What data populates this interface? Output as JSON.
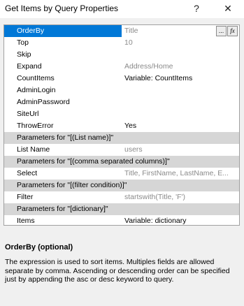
{
  "window": {
    "title": "Get Items by Query Properties",
    "help_label": "?",
    "close_label": "✕"
  },
  "grid": {
    "rows": [
      {
        "type": "prop",
        "name": "OrderBy",
        "value": "Title",
        "selected": true,
        "value_color": "gray"
      },
      {
        "type": "prop",
        "name": "Top",
        "value": "10",
        "value_color": "gray"
      },
      {
        "type": "prop",
        "name": "Skip",
        "value": ""
      },
      {
        "type": "prop",
        "name": "Expand",
        "value": "Address/Home",
        "value_color": "gray"
      },
      {
        "type": "prop",
        "name": "CountItems",
        "value": "Variable: CountItems"
      },
      {
        "type": "prop",
        "name": "AdminLogin",
        "value": ""
      },
      {
        "type": "prop",
        "name": "AdminPassword",
        "value": ""
      },
      {
        "type": "prop",
        "name": "SiteUrl",
        "value": ""
      },
      {
        "type": "prop",
        "name": "ThrowError",
        "value": "Yes"
      },
      {
        "type": "category",
        "name": "Parameters for \"[(List name)]\""
      },
      {
        "type": "prop",
        "name": "List Name",
        "value": "users",
        "value_color": "gray"
      },
      {
        "type": "category",
        "name": "Parameters for \"[(comma separated columns)]\""
      },
      {
        "type": "prop",
        "name": "Select",
        "value": "Title, FirstName, LastName, E...",
        "value_color": "gray"
      },
      {
        "type": "category",
        "name": "Parameters for \"[(filter condition)]\""
      },
      {
        "type": "prop",
        "name": "Filter",
        "value": "startswith(Title, 'F')",
        "value_color": "gray"
      },
      {
        "type": "category",
        "name": "Parameters for \"[dictionary]\""
      },
      {
        "type": "prop",
        "name": "Items",
        "value": "Variable: dictionary"
      }
    ],
    "ellipsis_button": "...",
    "fx_button": "fx"
  },
  "description": {
    "title": "OrderBy (optional)",
    "body": "The expression is used to sort items. Multiples fields are allowed separate by comma. Ascending or descending order can be specified just by appending the asc or desc keyword to query."
  }
}
